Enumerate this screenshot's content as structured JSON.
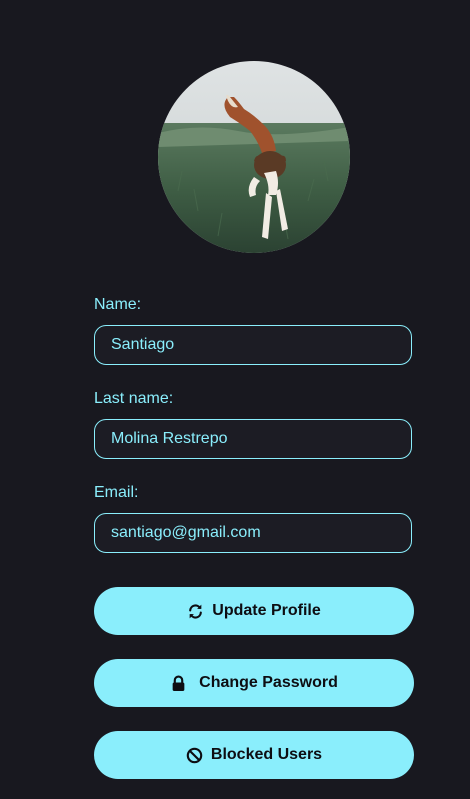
{
  "profile": {
    "avatar_icon": "dog-photo",
    "fields": {
      "name": {
        "label": "Name:",
        "value": "Santiago"
      },
      "last_name": {
        "label": "Last name:",
        "value": "Molina Restrepo"
      },
      "email": {
        "label": "Email:",
        "value": "santiago@gmail.com"
      }
    },
    "buttons": {
      "update": {
        "label": "Update Profile",
        "icon": "refresh-icon"
      },
      "password": {
        "label": "Change Password",
        "icon": "lock-icon"
      },
      "blocked": {
        "label": "Blocked Users",
        "icon": "block-icon"
      }
    }
  },
  "colors": {
    "background": "#18181f",
    "accent": "#8aeefc",
    "button_text": "#0d0d12"
  }
}
